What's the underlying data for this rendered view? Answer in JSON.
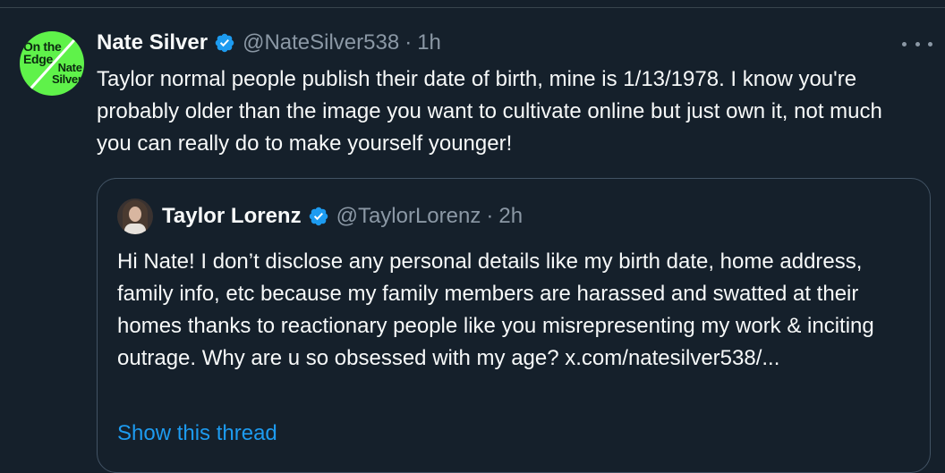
{
  "tweet": {
    "avatar": {
      "text_line1": "On the Edge",
      "text_line2": "Nate Silver"
    },
    "author_name": "Nate Silver",
    "handle": "@NateSilver538",
    "separator": "·",
    "time": "1h",
    "body": "Taylor normal people publish their date of birth, mine is 1/13/1978. I know you're probably older than the image you want to cultivate online but just own it, not much you can really do to make yourself younger!"
  },
  "quoted": {
    "author_name": "Taylor Lorenz",
    "handle": "@TaylorLorenz",
    "separator": "·",
    "time": "2h",
    "body": "Hi Nate! I don’t disclose any personal details like my birth date, home address, family info, etc because my family members are harassed and swatted at their homes thanks to reactionary people like you misrepresenting my work & inciting outrage. Why are u so obsessed with my age? ",
    "link": "x.com/natesilver538/...",
    "show_thread": "Show this thread"
  },
  "colors": {
    "background": "#15202b",
    "text": "#f7f9f9",
    "muted": "#8b98a5",
    "accent": "#1d9bf0",
    "verified": "#1d9bf0"
  }
}
